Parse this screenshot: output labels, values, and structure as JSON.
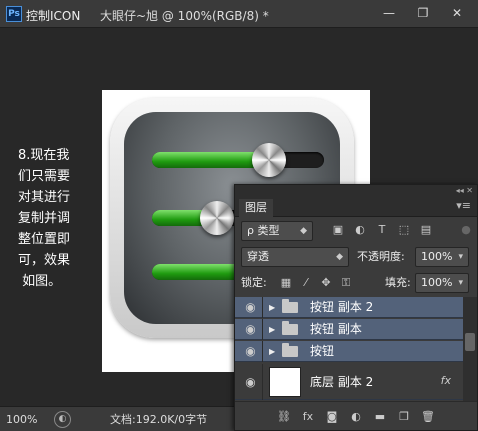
{
  "titlebar": {
    "logo": "Ps",
    "app_title": "控制ICON",
    "doc_title": "大眼仔~旭 @ 100%(RGB/8) *",
    "minimize": "—",
    "maximize": "❐",
    "close": "✕"
  },
  "note": "8.现在我\n们只需要\n对其进行\n复制并调\n整位置即\n可，效果\n 如图。",
  "sliders": [
    {
      "fill_percent": 0.68
    },
    {
      "fill_percent": 0.38
    },
    {
      "fill_percent": 1.0
    }
  ],
  "status": {
    "zoom": "100%",
    "doc_info": "文档:192.0K/0字节"
  },
  "layers_panel": {
    "collapse": "◂◂ ✕",
    "tab": "图层",
    "menu": "▾≡",
    "filter_label": "ρ 类型",
    "blend_mode": "穿透",
    "opacity_label": "不透明度:",
    "opacity_value": "100%",
    "lock_label": "锁定:",
    "fill_label": "填充:",
    "fill_value": "100%",
    "layers": [
      {
        "name": "按钮 副本 2",
        "type": "group"
      },
      {
        "name": "按钮 副本",
        "type": "group"
      },
      {
        "name": "按钮",
        "type": "group"
      },
      {
        "name": "底层 副本 2",
        "type": "layer",
        "fx": "fx"
      }
    ],
    "footer_icons": [
      "link-icon",
      "fx-icon",
      "mask-icon",
      "adjustment-icon",
      "group-icon",
      "new-layer-icon",
      "trash-icon"
    ]
  },
  "colors": {
    "accent_arrow": "#c0392b",
    "slider_green": "#1f9b10",
    "selected_layer": "#53627a"
  }
}
